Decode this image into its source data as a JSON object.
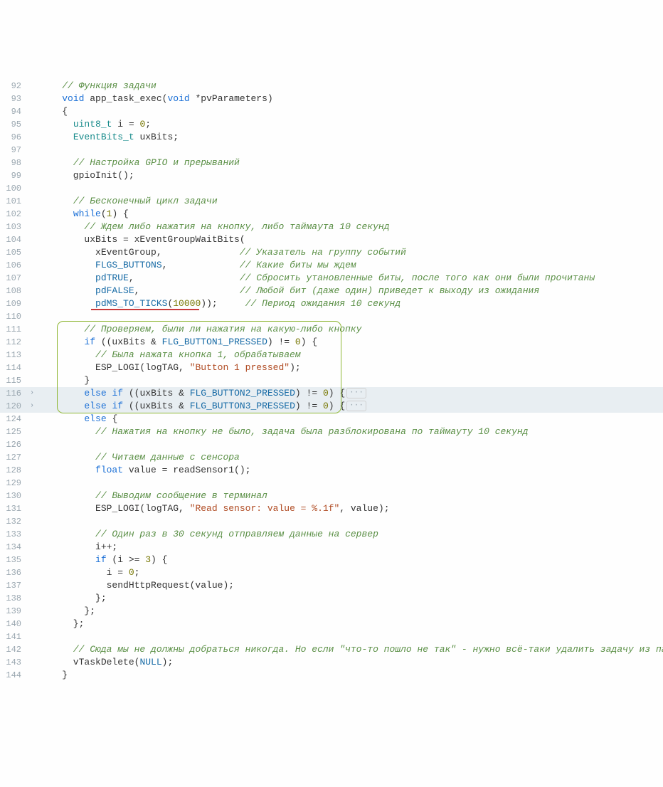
{
  "fold_marker": "›",
  "ellipsis": "···",
  "lines": [
    {
      "n": 92,
      "tokens": [
        {
          "t": "    ",
          "c": "c-plain"
        },
        {
          "t": "// Функция задачи",
          "c": "c-com"
        }
      ]
    },
    {
      "n": 93,
      "tokens": [
        {
          "t": "    ",
          "c": "c-plain"
        },
        {
          "t": "void",
          "c": "c-kw"
        },
        {
          "t": " app_task_exec(",
          "c": "c-plain"
        },
        {
          "t": "void",
          "c": "c-kw"
        },
        {
          "t": " *pvParameters)",
          "c": "c-plain"
        }
      ]
    },
    {
      "n": 94,
      "tokens": [
        {
          "t": "    {",
          "c": "c-plain"
        }
      ]
    },
    {
      "n": 95,
      "tokens": [
        {
          "t": "      ",
          "c": "c-plain"
        },
        {
          "t": "uint8_t",
          "c": "c-idtype"
        },
        {
          "t": " i = ",
          "c": "c-plain"
        },
        {
          "t": "0",
          "c": "c-num"
        },
        {
          "t": ";",
          "c": "c-plain"
        }
      ]
    },
    {
      "n": 96,
      "tokens": [
        {
          "t": "      ",
          "c": "c-plain"
        },
        {
          "t": "EventBits_t",
          "c": "c-idtype"
        },
        {
          "t": " uxBits;",
          "c": "c-plain"
        }
      ]
    },
    {
      "n": 97,
      "tokens": []
    },
    {
      "n": 98,
      "tokens": [
        {
          "t": "      ",
          "c": "c-plain"
        },
        {
          "t": "// Настройка GPIO и прерываний",
          "c": "c-com"
        }
      ]
    },
    {
      "n": 99,
      "tokens": [
        {
          "t": "      gpioInit();",
          "c": "c-plain"
        }
      ]
    },
    {
      "n": 100,
      "tokens": []
    },
    {
      "n": 101,
      "tokens": [
        {
          "t": "      ",
          "c": "c-plain"
        },
        {
          "t": "// Бесконечный цикл задачи",
          "c": "c-com"
        }
      ]
    },
    {
      "n": 102,
      "tokens": [
        {
          "t": "      ",
          "c": "c-plain"
        },
        {
          "t": "while",
          "c": "c-kw"
        },
        {
          "t": "(",
          "c": "c-plain"
        },
        {
          "t": "1",
          "c": "c-num"
        },
        {
          "t": ") {",
          "c": "c-plain"
        }
      ]
    },
    {
      "n": 103,
      "tokens": [
        {
          "t": "        ",
          "c": "c-plain"
        },
        {
          "t": "// Ждем либо нажатия на кнопку, либо таймаута 10 секунд",
          "c": "c-com"
        }
      ]
    },
    {
      "n": 104,
      "tokens": [
        {
          "t": "        uxBits = xEventGroupWaitBits(",
          "c": "c-plain"
        }
      ]
    },
    {
      "n": 105,
      "tokens": [
        {
          "t": "          xEventGroup,              ",
          "c": "c-plain"
        },
        {
          "t": "// Указатель на группу событий",
          "c": "c-com"
        }
      ]
    },
    {
      "n": 106,
      "tokens": [
        {
          "t": "          ",
          "c": "c-plain"
        },
        {
          "t": "FLGS_BUTTONS",
          "c": "c-const"
        },
        {
          "t": ",             ",
          "c": "c-plain"
        },
        {
          "t": "// Какие биты мы ждем",
          "c": "c-com"
        }
      ]
    },
    {
      "n": 107,
      "tokens": [
        {
          "t": "          ",
          "c": "c-plain"
        },
        {
          "t": "pdTRUE",
          "c": "c-const"
        },
        {
          "t": ",                   ",
          "c": "c-plain"
        },
        {
          "t": "// Сбросить утановленные биты, после того как они были прочитаны",
          "c": "c-com"
        }
      ]
    },
    {
      "n": 108,
      "tokens": [
        {
          "t": "          ",
          "c": "c-plain"
        },
        {
          "t": "pdFALSE",
          "c": "c-const"
        },
        {
          "t": ",                  ",
          "c": "c-plain"
        },
        {
          "t": "// Любой бит (даже один) приведет к выходу из ожидания",
          "c": "c-com"
        }
      ]
    },
    {
      "n": 109,
      "tokens": [
        {
          "t": "          ",
          "c": "c-plain"
        },
        {
          "t": "pdMS_TO_TICKS",
          "c": "c-const"
        },
        {
          "t": "(",
          "c": "c-plain"
        },
        {
          "t": "10000",
          "c": "c-num"
        },
        {
          "t": "));     ",
          "c": "c-plain"
        },
        {
          "t": "// Период ожидания 10 секунд",
          "c": "c-com"
        }
      ]
    },
    {
      "n": 110,
      "tokens": []
    },
    {
      "n": 111,
      "tokens": [
        {
          "t": "        ",
          "c": "c-plain"
        },
        {
          "t": "// Проверяем, были ли нажатия на какую-либо кнопку",
          "c": "c-com"
        }
      ]
    },
    {
      "n": 112,
      "tokens": [
        {
          "t": "        ",
          "c": "c-plain"
        },
        {
          "t": "if",
          "c": "c-kw"
        },
        {
          "t": " ((uxBits & ",
          "c": "c-plain"
        },
        {
          "t": "FLG_BUTTON1_PRESSED",
          "c": "c-const"
        },
        {
          "t": ") != ",
          "c": "c-plain"
        },
        {
          "t": "0",
          "c": "c-num"
        },
        {
          "t": ") {",
          "c": "c-plain"
        }
      ]
    },
    {
      "n": 113,
      "tokens": [
        {
          "t": "          ",
          "c": "c-plain"
        },
        {
          "t": "// Была нажата кнопка 1, обрабатываем",
          "c": "c-com"
        }
      ]
    },
    {
      "n": 114,
      "tokens": [
        {
          "t": "          ESP_LOGI(logTAG, ",
          "c": "c-plain"
        },
        {
          "t": "\"Button 1 pressed\"",
          "c": "c-str"
        },
        {
          "t": ");",
          "c": "c-plain"
        }
      ]
    },
    {
      "n": 115,
      "tokens": [
        {
          "t": "        }",
          "c": "c-plain"
        }
      ]
    },
    {
      "n": 116,
      "fold": true,
      "hl": true,
      "tokens": [
        {
          "t": "        ",
          "c": "c-plain"
        },
        {
          "t": "else",
          "c": "c-kw"
        },
        {
          "t": " ",
          "c": "c-plain"
        },
        {
          "t": "if",
          "c": "c-kw"
        },
        {
          "t": " ((uxBits & ",
          "c": "c-plain"
        },
        {
          "t": "FLG_BUTTON2_PRESSED",
          "c": "c-const"
        },
        {
          "t": ") != ",
          "c": "c-plain"
        },
        {
          "t": "0",
          "c": "c-num"
        },
        {
          "t": ") {",
          "c": "c-plain"
        }
      ],
      "ellipsis": true
    },
    {
      "n": 120,
      "fold": true,
      "hl": true,
      "tokens": [
        {
          "t": "        ",
          "c": "c-plain"
        },
        {
          "t": "else",
          "c": "c-kw"
        },
        {
          "t": " ",
          "c": "c-plain"
        },
        {
          "t": "if",
          "c": "c-kw"
        },
        {
          "t": " ((uxBits & ",
          "c": "c-plain"
        },
        {
          "t": "FLG_BUTTON3_PRESSED",
          "c": "c-const"
        },
        {
          "t": ") != ",
          "c": "c-plain"
        },
        {
          "t": "0",
          "c": "c-num"
        },
        {
          "t": ") {",
          "c": "c-plain"
        }
      ],
      "ellipsis": true
    },
    {
      "n": 124,
      "tokens": [
        {
          "t": "        ",
          "c": "c-plain"
        },
        {
          "t": "else",
          "c": "c-kw"
        },
        {
          "t": " {",
          "c": "c-plain"
        }
      ]
    },
    {
      "n": 125,
      "tokens": [
        {
          "t": "          ",
          "c": "c-plain"
        },
        {
          "t": "// Нажатия на кнопку не было, задача была разблокирована по таймауту 10 секунд",
          "c": "c-com"
        }
      ]
    },
    {
      "n": 126,
      "tokens": []
    },
    {
      "n": 127,
      "tokens": [
        {
          "t": "          ",
          "c": "c-plain"
        },
        {
          "t": "// Читаем данные с сенсора",
          "c": "c-com"
        }
      ]
    },
    {
      "n": 128,
      "tokens": [
        {
          "t": "          ",
          "c": "c-plain"
        },
        {
          "t": "float",
          "c": "c-kw"
        },
        {
          "t": " value = readSensor1();",
          "c": "c-plain"
        }
      ]
    },
    {
      "n": 129,
      "tokens": []
    },
    {
      "n": 130,
      "tokens": [
        {
          "t": "          ",
          "c": "c-plain"
        },
        {
          "t": "// Выводим сообщение в терминал",
          "c": "c-com"
        }
      ]
    },
    {
      "n": 131,
      "tokens": [
        {
          "t": "          ESP_LOGI(logTAG, ",
          "c": "c-plain"
        },
        {
          "t": "\"Read sensor: value = %.1f\"",
          "c": "c-str"
        },
        {
          "t": ", value);",
          "c": "c-plain"
        }
      ]
    },
    {
      "n": 132,
      "tokens": []
    },
    {
      "n": 133,
      "tokens": [
        {
          "t": "          ",
          "c": "c-plain"
        },
        {
          "t": "// Один раз в 30 секунд отправляем данные на сервер",
          "c": "c-com"
        }
      ]
    },
    {
      "n": 134,
      "tokens": [
        {
          "t": "          i++;",
          "c": "c-plain"
        }
      ]
    },
    {
      "n": 135,
      "tokens": [
        {
          "t": "          ",
          "c": "c-plain"
        },
        {
          "t": "if",
          "c": "c-kw"
        },
        {
          "t": " (i >= ",
          "c": "c-plain"
        },
        {
          "t": "3",
          "c": "c-num"
        },
        {
          "t": ") {",
          "c": "c-plain"
        }
      ]
    },
    {
      "n": 136,
      "tokens": [
        {
          "t": "            i = ",
          "c": "c-plain"
        },
        {
          "t": "0",
          "c": "c-num"
        },
        {
          "t": ";",
          "c": "c-plain"
        }
      ]
    },
    {
      "n": 137,
      "tokens": [
        {
          "t": "            sendHttpRequest(value);",
          "c": "c-plain"
        }
      ]
    },
    {
      "n": 138,
      "tokens": [
        {
          "t": "          };",
          "c": "c-plain"
        }
      ]
    },
    {
      "n": 139,
      "tokens": [
        {
          "t": "        };",
          "c": "c-plain"
        }
      ]
    },
    {
      "n": 140,
      "tokens": [
        {
          "t": "      };",
          "c": "c-plain"
        }
      ]
    },
    {
      "n": 141,
      "tokens": []
    },
    {
      "n": 142,
      "tokens": [
        {
          "t": "      ",
          "c": "c-plain"
        },
        {
          "t": "// Сюда мы не должны добраться никогда. Но если \"что-то пошло не так\" - нужно всё-таки удалить задачу из памяти",
          "c": "c-com"
        }
      ]
    },
    {
      "n": 143,
      "tokens": [
        {
          "t": "      vTaskDelete(",
          "c": "c-plain"
        },
        {
          "t": "NULL",
          "c": "c-const"
        },
        {
          "t": ");",
          "c": "c-plain"
        }
      ]
    },
    {
      "n": 144,
      "tokens": [
        {
          "t": "    }",
          "c": "c-plain"
        }
      ]
    }
  ],
  "annotations": {
    "green_box_lines": [
      111,
      120
    ],
    "red_underline_line": 109
  }
}
